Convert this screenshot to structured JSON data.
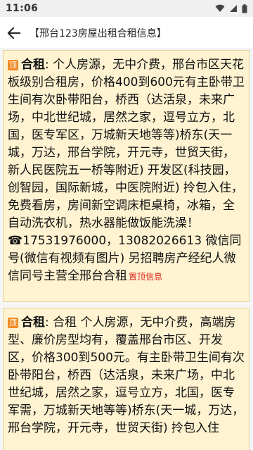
{
  "status_bar": {
    "time": "11:06"
  },
  "app_bar": {
    "title": "【邢台123房屋出租合租信息】"
  },
  "listings": [
    {
      "badge": "顶",
      "tag": "合租",
      "text": ": 个人房源，无中介费，邢台市区天花板级别合租房，价格400到600元有主卧带卫生间有次卧带阳台，桥西（达活泉，未来广场，中北世纪城，居然之家，逗号立方，北国，医专军区，万城新天地等等)桥东(天一城，万达，邢台学院，开元寺，世贸天街，新人民医院五一桥等附近) 开发区(科技园，创智园，国际新城，中医院附近) 拎包入住，免费看房，房间新空调床柜桌椅，冰箱，全自动洗衣机，热水器能做饭能洗澡！ ☎17531976000，13082026613 微信同号(微信有视频有图片) 另招聘房产经纪人微信同号主营全邢台合租",
      "pin_label": "置顶信息"
    },
    {
      "badge": "顶",
      "tag": "合租",
      "text": ": 合租 个人房源，无中介费，高端房型、廉价房型均有，覆盖邢台市区、开发区，价格300到500元。有主卧带卫生间有次卧带阳台，桥西（达活泉，未来广场，中北世纪城，居然之家，逗号立方，北国，医专军需，万城新天地等等)桥东(天一城，万达，邢台学院，开元寺，世贸天街) 拎包入住"
    }
  ]
}
